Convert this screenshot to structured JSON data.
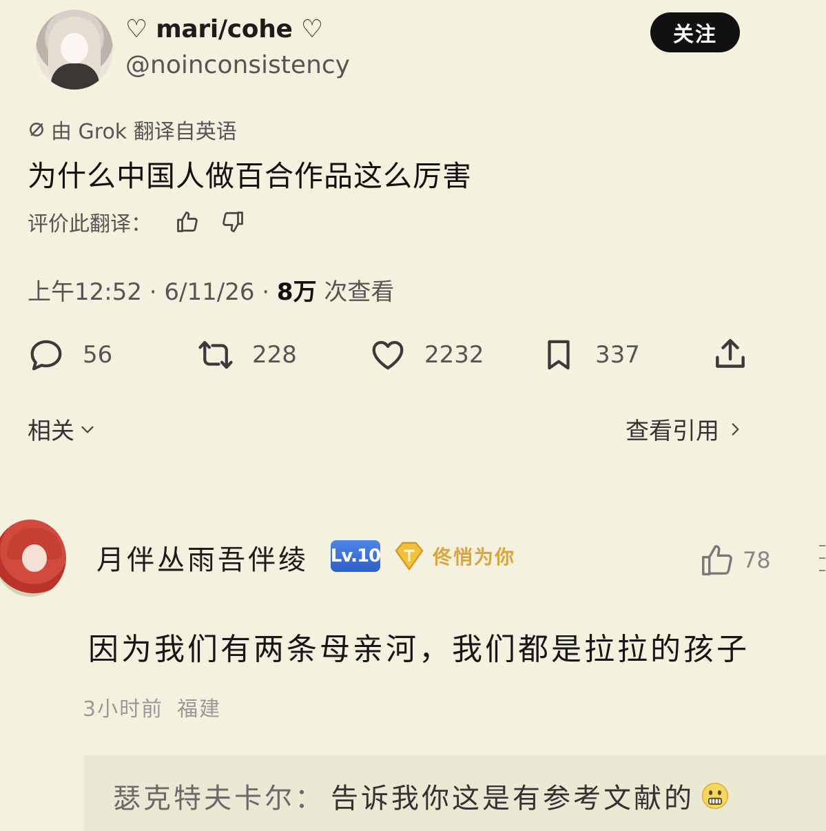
{
  "tweet": {
    "display_name": "♡ mari/cohe ♡",
    "handle": "@noinconsistency",
    "follow_label": "关注",
    "translated_by": "由 Grok 翻译自英语",
    "text": "为什么中国人做百合作品这么厉害",
    "rate_translation_label": "评价此翻译：",
    "time_date": "上午12:52 · 6/11/26 · ",
    "views_count": "8万",
    "views_label": " 次查看",
    "stats": {
      "replies": "56",
      "reposts": "228",
      "likes": "2232",
      "bookmarks": "337"
    },
    "related_label": "相关",
    "view_quotes_label": "查看引用"
  },
  "comment": {
    "username": "月伴丛雨吾伴绫",
    "level_badge": "Lv.10",
    "vip_badge_text": "佟悄为你",
    "likes": "78",
    "text": "因为我们有两条母亲河，我们都是拉拉的孩子",
    "time": "3小时前",
    "location": "福建",
    "reply": {
      "author": "瑟克特夫卡尔：",
      "text": "告诉我你这是有参考文献的"
    }
  },
  "colors": {
    "background": "#f4f2de",
    "follow_button": "#111111",
    "level_badge": "#2d5fc9",
    "vip_gold": "#d9a53c"
  }
}
